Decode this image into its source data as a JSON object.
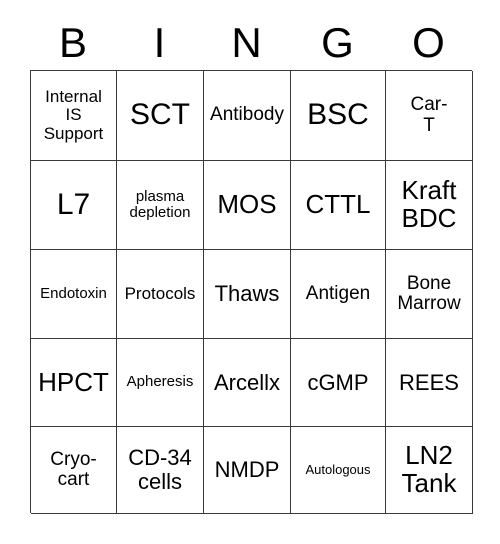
{
  "card": {
    "header_letters": [
      "B",
      "I",
      "N",
      "G",
      "O"
    ],
    "rows": [
      [
        {
          "text": "Internal\nIS\nSupport",
          "size": "fs-m"
        },
        {
          "text": "SCT",
          "size": "fs-xxl"
        },
        {
          "text": "Antibody",
          "size": "fs-ml"
        },
        {
          "text": "BSC",
          "size": "fs-xxl"
        },
        {
          "text": "Car-\nT",
          "size": "fs-ml"
        }
      ],
      [
        {
          "text": "L7",
          "size": "fs-xxl"
        },
        {
          "text": "plasma\ndepletion",
          "size": "fs-s"
        },
        {
          "text": "MOS",
          "size": "fs-xl"
        },
        {
          "text": "CTTL",
          "size": "fs-xl"
        },
        {
          "text": "Kraft\nBDC",
          "size": "fs-xl"
        }
      ],
      [
        {
          "text": "Endotoxin",
          "size": "fs-s"
        },
        {
          "text": "Protocols",
          "size": "fs-m"
        },
        {
          "text": "Thaws",
          "size": "fs-l"
        },
        {
          "text": "Antigen",
          "size": "fs-ml"
        },
        {
          "text": "Bone\nMarrow",
          "size": "fs-ml"
        }
      ],
      [
        {
          "text": "HPCT",
          "size": "fs-xl"
        },
        {
          "text": "Apheresis",
          "size": "fs-s"
        },
        {
          "text": "Arcellx",
          "size": "fs-l"
        },
        {
          "text": "cGMP",
          "size": "fs-l"
        },
        {
          "text": "REES",
          "size": "fs-l"
        }
      ],
      [
        {
          "text": "Cryo-\ncart",
          "size": "fs-ml"
        },
        {
          "text": "CD-34\ncells",
          "size": "fs-l"
        },
        {
          "text": "NMDP",
          "size": "fs-l"
        },
        {
          "text": "Autologous",
          "size": "fs-xs"
        },
        {
          "text": "LN2\nTank",
          "size": "fs-xl"
        }
      ]
    ]
  }
}
